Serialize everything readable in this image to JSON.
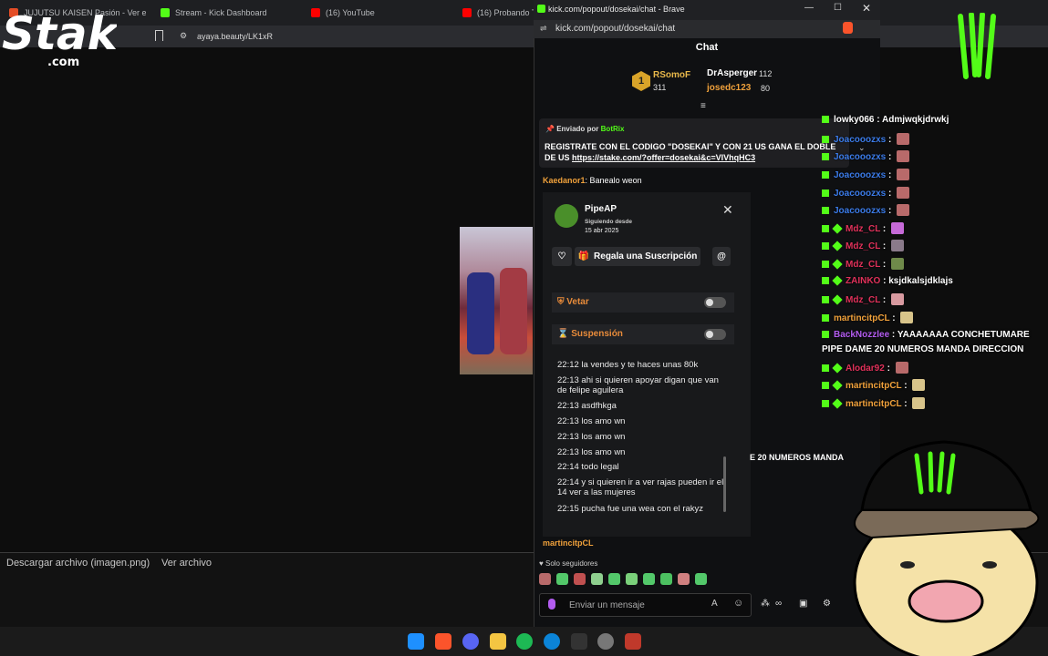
{
  "background_browser": {
    "tabs": [
      {
        "label": "JUJUTSU KAISEN Pasión - Ver en Cru",
        "color": "#e44d26"
      },
      {
        "label": "Stream - Kick Dashboard",
        "color": "#53fc18"
      },
      {
        "label": "(16) YouTube",
        "color": "#ff0000"
      },
      {
        "label": "(16) Probando TO",
        "color": "#ff0000"
      }
    ],
    "url": "ayaya.beauty/LK1xR",
    "download_name": "Descargar archivo (imagen.png)",
    "download_view": "Ver archivo"
  },
  "popout": {
    "window_title": "kick.com/popout/dosekai/chat - Brave",
    "url": "kick.com/popout/dosekai/chat",
    "header": "Chat",
    "ranking": [
      {
        "rank": "1",
        "name": "RSomoF",
        "count": "311"
      },
      {
        "name": "DrAsperger",
        "count": "112"
      },
      {
        "name": "josedc123",
        "count": "80"
      }
    ],
    "pinned": {
      "by_label": "Enviado por",
      "by_user": "BotRix",
      "text": "REGISTRATE CON EL CODIGO \"DOSEKAI\" Y CON 21 US GANA EL DOBLE DE US",
      "link": "https://stake.com/?offer=dosekai&c=VIVhqHC3"
    },
    "last_message": {
      "user": "Kaedanor1",
      "text": "Banealo weon"
    },
    "user_card": {
      "username": "PipeAP",
      "since_label": "Siguiendo desde",
      "since_date": "15 abr 2025",
      "gift_label": "Regala una Suscripción",
      "mod_actions": [
        "Vetar",
        "Suspensión"
      ],
      "history": [
        "22:12 la vendes y te haces unas 80k",
        "22:13 ahi si quieren apoyar digan que van de felipe aguilera",
        "22:13 asdfhkga",
        "22:13 los amo wn",
        "22:13 los amo wn",
        "22:13 los amo wn",
        "22:14 todo legal",
        "22:14 y si quieren ir a ver rajas pueden ir el 14 ver a las mujeres",
        "22:15 pucha fue una wea con el rakyz"
      ]
    },
    "bottom_user": "martincitpCL",
    "followers_only": "Solo seguidores",
    "input_placeholder": "Enviar un mensaje"
  },
  "overlay_chat": [
    {
      "user": "lowky066",
      "text": "Admjwqkjdrwkj",
      "color": "#ffffff"
    },
    {
      "user": "Joacooozxs",
      "text": "",
      "color": "#3b7be8"
    },
    {
      "user": "Joacooozxs",
      "text": "",
      "color": "#3b7be8"
    },
    {
      "user": "Joacooozxs",
      "text": "",
      "color": "#3b7be8"
    },
    {
      "user": "Joacooozxs",
      "text": "",
      "color": "#3b7be8"
    },
    {
      "user": "Joacooozxs",
      "text": "",
      "color": "#3b7be8"
    },
    {
      "user": "Mdz_CL",
      "text": "",
      "color": "#e0315a"
    },
    {
      "user": "Mdz_CL",
      "text": "",
      "color": "#e0315a"
    },
    {
      "user": "Mdz_CL",
      "text": "",
      "color": "#e0315a"
    },
    {
      "user": "ZAINKO",
      "text": "ksjdkalsjdklajs",
      "color": "#e0315a"
    },
    {
      "user": "Mdz_CL",
      "text": "",
      "color": "#e0315a"
    },
    {
      "user": "martincitpCL",
      "text": "",
      "color": "#f0a13b"
    },
    {
      "user": "BackNozzlee",
      "text": "YAAAAAAA CONCHETUMARE",
      "color": "#b35cf0"
    },
    {
      "user": "",
      "text": "PIPE DAME 20 NUMEROS MANDA DIRECCION",
      "color": "#ffffff"
    },
    {
      "user": "Alodar92",
      "text": "",
      "color": "#e0315a"
    },
    {
      "user": "martincitpCL",
      "text": "",
      "color": "#f0a13b"
    },
    {
      "user": "martincitpCL",
      "text": "",
      "color": "#f0a13b"
    }
  ],
  "overlay_dup_text": "E 20 NUMEROS MANDA",
  "stake_logo_text": "Stake",
  "stake_logo_sub": ".com"
}
